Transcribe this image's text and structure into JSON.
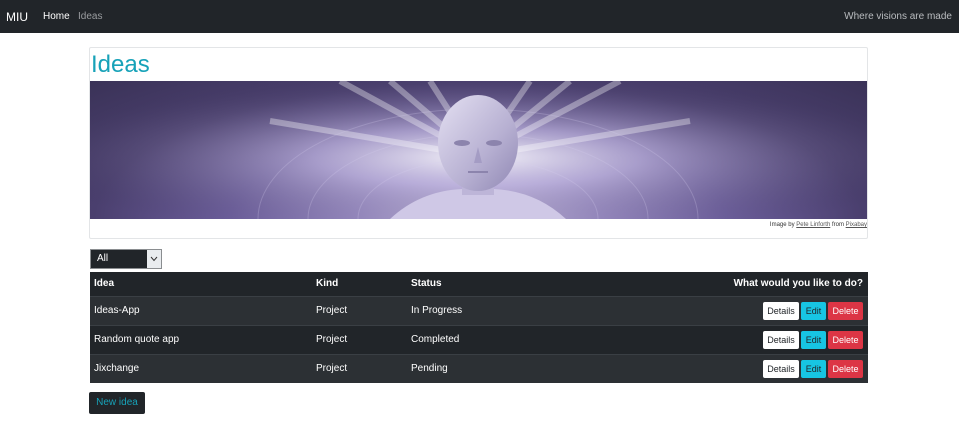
{
  "navbar": {
    "brand": "MIU",
    "links": [
      {
        "label": "Home"
      },
      {
        "label": "Ideas"
      }
    ],
    "tagline": "Where visions are made"
  },
  "main": {
    "title": "Ideas",
    "image_credit": {
      "prefix": "Image by ",
      "author": "Pete Linforth",
      "middle": " from ",
      "source": "Pixabay"
    },
    "filter": {
      "selected": "All"
    },
    "table": {
      "headers": {
        "idea": "Idea",
        "kind": "Kind",
        "status": "Status",
        "actions": "What would you like to do?"
      },
      "rows": [
        {
          "idea": "Ideas-App",
          "kind": "Project",
          "status": "In Progress"
        },
        {
          "idea": "Random quote app",
          "kind": "Project",
          "status": "Completed"
        },
        {
          "idea": "Jixchange",
          "kind": "Project",
          "status": "Pending"
        }
      ],
      "action_labels": {
        "details": "Details",
        "edit": "Edit",
        "delete": "Delete"
      }
    },
    "new_idea_label": "New idea"
  },
  "colors": {
    "navbar_bg": "#212529",
    "accent": "#17a2b8",
    "edit_button": "#17c5e3",
    "delete_button": "#dc3545"
  },
  "icons": {
    "filter_arrow": "chevron-down-icon",
    "hero": "android-face-illustration"
  }
}
